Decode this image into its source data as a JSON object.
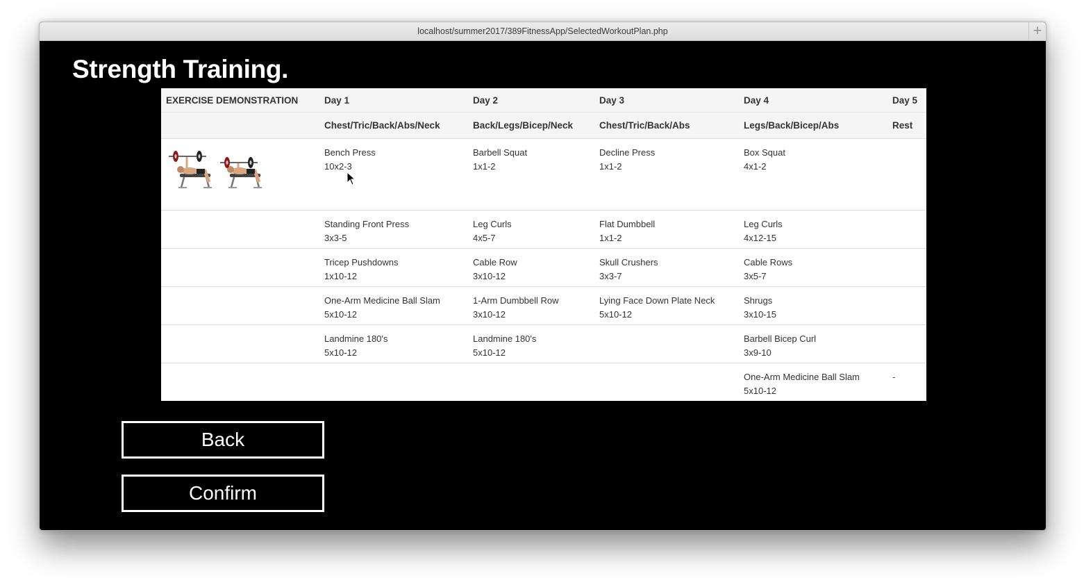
{
  "browser": {
    "url": "localhost/summer2017/389FitnessApp/SelectedWorkoutPlan.php",
    "new_tab_glyph": "+"
  },
  "page": {
    "title": "Strength Training."
  },
  "table": {
    "header": [
      "EXERCISE DEMONSTRATION",
      "Day 1",
      "Day 2",
      "Day 3",
      "Day 4",
      "Day 5"
    ],
    "subheader": [
      "",
      "Chest/Tric/Back/Abs/Neck",
      "Back/Legs/Bicep/Neck",
      "Chest/Tric/Back/Abs",
      "Legs/Back/Bicep/Abs",
      "Rest"
    ],
    "demo_image": "bench-press-demo-image",
    "rows": [
      [
        {
          "name": "Bench Press",
          "sets": "10x2-3"
        },
        {
          "name": "Barbell Squat",
          "sets": "1x1-2"
        },
        {
          "name": "Decline Press",
          "sets": "1x1-2"
        },
        {
          "name": "Box Squat",
          "sets": "4x1-2"
        },
        {
          "name": "",
          "sets": ""
        }
      ],
      [
        {
          "name": "Standing Front Press",
          "sets": "3x3-5"
        },
        {
          "name": "Leg Curls",
          "sets": "4x5-7"
        },
        {
          "name": "Flat Dumbbell",
          "sets": "1x1-2"
        },
        {
          "name": "Leg Curls",
          "sets": "4x12-15"
        },
        {
          "name": "",
          "sets": ""
        }
      ],
      [
        {
          "name": "Tricep Pushdowns",
          "sets": "1x10-12"
        },
        {
          "name": "Cable Row",
          "sets": "3x10-12"
        },
        {
          "name": "Skull Crushers",
          "sets": "3x3-7"
        },
        {
          "name": "Cable Rows",
          "sets": "3x5-7"
        },
        {
          "name": "",
          "sets": ""
        }
      ],
      [
        {
          "name": "One-Arm Medicine Ball Slam",
          "sets": "5x10-12"
        },
        {
          "name": "1-Arm Dumbbell Row",
          "sets": "3x10-12"
        },
        {
          "name": "Lying Face Down Plate Neck",
          "sets": "5x10-12"
        },
        {
          "name": "Shrugs",
          "sets": "3x10-15"
        },
        {
          "name": "",
          "sets": ""
        }
      ],
      [
        {
          "name": "Landmine 180's",
          "sets": "5x10-12"
        },
        {
          "name": "Landmine 180's",
          "sets": "5x10-12"
        },
        {
          "name": "",
          "sets": ""
        },
        {
          "name": "Barbell Bicep Curl",
          "sets": "3x9-10"
        },
        {
          "name": "",
          "sets": ""
        }
      ],
      [
        {
          "name": "",
          "sets": ""
        },
        {
          "name": "",
          "sets": ""
        },
        {
          "name": "",
          "sets": ""
        },
        {
          "name": "One-Arm Medicine Ball Slam",
          "sets": "5x10-12"
        },
        {
          "name": "-",
          "sets": ""
        }
      ]
    ]
  },
  "buttons": {
    "back_label": "Back",
    "confirm_label": "Confirm"
  },
  "colors": {
    "page_background": "#000000",
    "table_background": "#ffffff",
    "header_background": "#f5f5f5",
    "button_border": "#ffffff"
  }
}
